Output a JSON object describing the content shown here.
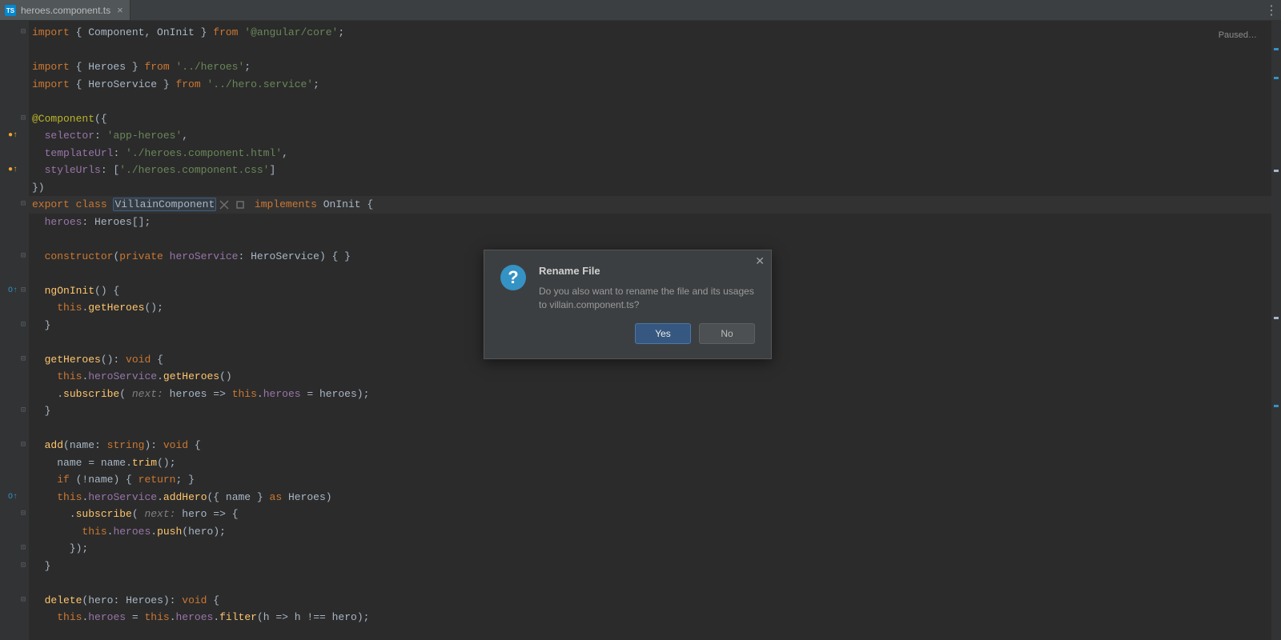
{
  "tab": {
    "filename": "heroes.component.ts",
    "icon": "ts-file-icon"
  },
  "status": {
    "paused": "Paused…"
  },
  "code": {
    "l1": "import { Component, OnInit } from '@angular/core';",
    "l3": "import { Heroes } from '../heroes';",
    "l4": "import { HeroService } from '../hero.service';",
    "l6": "@Component({",
    "l7": "  selector: 'app-heroes',",
    "l8": "  templateUrl: './heroes.component.html',",
    "l9": "  styleUrls: ['./heroes.component.css']",
    "l10": "})",
    "l11_a": "export class ",
    "l11_class": "VillainComponent",
    "l11_b": " implements OnInit {",
    "l12": "  heroes: Heroes[];",
    "l14": "  constructor(private heroService: HeroService) { }",
    "l16": "  ngOnInit() {",
    "l17": "    this.getHeroes();",
    "l18": "  }",
    "l20": "  getHeroes(): void {",
    "l21": "    this.heroService.getHeroes()",
    "l22a": "    .subscribe( ",
    "l22hint": "next:",
    "l22b": " heroes => this.heroes = heroes);",
    "l23": "  }",
    "l25": "  add(name: string): void {",
    "l26": "    name = name.trim();",
    "l27": "    if (!name) { return; }",
    "l28": "    this.heroService.addHero({ name } as Heroes)",
    "l29a": "      .subscribe( ",
    "l29hint": "next:",
    "l29b": " hero => {",
    "l30": "        this.heroes.push(hero);",
    "l31": "      });",
    "l32": "  }",
    "l34": "  delete(hero: Heroes): void {",
    "l35": "    this.heroes = this.heroes.filter(h => h !== hero);"
  },
  "dialog": {
    "title": "Rename File",
    "message": "Do you also want to rename the file and its usages to villain.component.ts?",
    "yes": "Yes",
    "no": "No"
  }
}
